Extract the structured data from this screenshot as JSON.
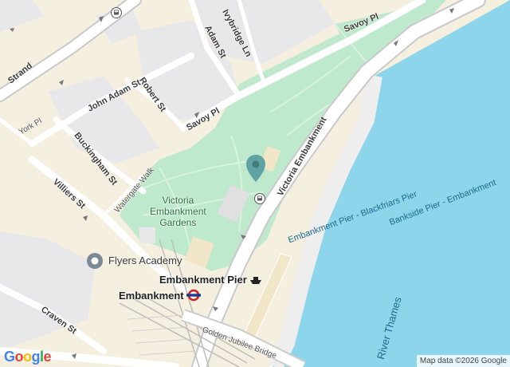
{
  "map": {
    "streets": {
      "strand": "Strand",
      "john_adam_st": "John Adam St",
      "robert_st": "Robert St",
      "adam_st": "Adam St",
      "ivybridge_ln": "Ivybridge Ln",
      "savoy_pl_top": "Savoy Pl",
      "savoy_pl": "Savoy Pl",
      "york_pl": "York Pl",
      "buckingham_st": "Buckingham St",
      "watergate_walk": "Watergate Walk",
      "villiers_st": "Villiers St",
      "craven_st": "Craven St",
      "victoria_embankment": "Victoria Embankment",
      "golden_jubilee_bridge": "Golden Jubilee Bridge"
    },
    "park": {
      "line1": "Victoria",
      "line2": "Embankment",
      "line3": "Gardens"
    },
    "places": {
      "flyers_academy": "Flyers Academy",
      "embankment_pier": "Embankment Pier",
      "embankment_station": "Embankment"
    },
    "water": {
      "river": "River Thames",
      "route1": "Embankment Pier - Blackfriars Pier",
      "route2": "Bankside Pier - Embankment"
    },
    "icons": {
      "location_pin": "location-pin-icon",
      "underground": "underground-roundel-icon",
      "ferry": "ferry-icon",
      "place": "place-marker-icon",
      "bus_stop": "bus-stop-icon"
    },
    "colors": {
      "land": "#f5efdf",
      "park": "#bfe9cc",
      "water": "#8dd5ea",
      "road": "#ffffff",
      "pin": "#5fa3a3",
      "underground": "#d0201f"
    }
  },
  "brand": {
    "logo": "Google"
  },
  "attribution": "Map data ©2026 Google"
}
